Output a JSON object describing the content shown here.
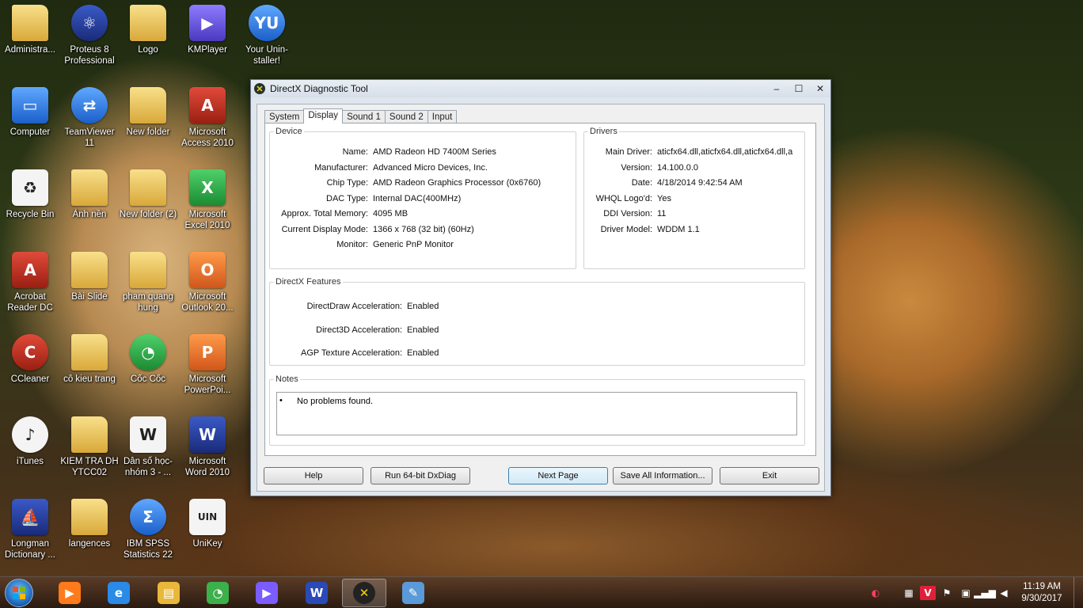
{
  "desktop": {
    "icons": [
      {
        "label": "Administra...",
        "icon": "user-folder-icon"
      },
      {
        "label": "Proteus 8 Professional",
        "icon": "proteus-icon"
      },
      {
        "label": "Logo",
        "icon": "folder-icon"
      },
      {
        "label": "KMPlayer",
        "icon": "kmplayer-icon"
      },
      {
        "label": "Your Unin-staller!",
        "icon": "uninstaller-icon"
      },
      {
        "label": "Computer",
        "icon": "computer-icon"
      },
      {
        "label": "TeamViewer 11",
        "icon": "teamviewer-icon"
      },
      {
        "label": "New folder",
        "icon": "folder-icon"
      },
      {
        "label": "Microsoft Access 2010",
        "icon": "access-icon"
      },
      {
        "label": "Recycle Bin",
        "icon": "recycle-bin-icon"
      },
      {
        "label": "Ảnh nền",
        "icon": "folder-icon"
      },
      {
        "label": "New folder (2)",
        "icon": "folder-icon"
      },
      {
        "label": "Microsoft Excel 2010",
        "icon": "excel-icon"
      },
      {
        "label": "Acrobat Reader DC",
        "icon": "acrobat-icon"
      },
      {
        "label": "Bài Slide",
        "icon": "folder-icon"
      },
      {
        "label": "pham quang hung",
        "icon": "folder-icon"
      },
      {
        "label": "Microsoft Outlook 20...",
        "icon": "outlook-icon"
      },
      {
        "label": "CCleaner",
        "icon": "ccleaner-icon"
      },
      {
        "label": "cô kieu trang",
        "icon": "folder-icon"
      },
      {
        "label": "Cốc Cốc",
        "icon": "coccoc-icon"
      },
      {
        "label": "Microsoft PowerPoi...",
        "icon": "powerpoint-icon"
      },
      {
        "label": "iTunes",
        "icon": "itunes-icon"
      },
      {
        "label": "KIEM TRA DH YTCC02",
        "icon": "folder-icon"
      },
      {
        "label": "Dân số học- nhóm 3 - ...",
        "icon": "word-doc-icon"
      },
      {
        "label": "Microsoft Word 2010",
        "icon": "word-icon"
      },
      {
        "label": "Longman Dictionary ...",
        "icon": "longman-icon"
      },
      {
        "label": "langences",
        "icon": "folder-icon"
      },
      {
        "label": "IBM SPSS Statistics 22",
        "icon": "spss-icon"
      },
      {
        "label": "UniKey",
        "icon": "unikey-icon"
      }
    ]
  },
  "window": {
    "title": "DirectX Diagnostic Tool",
    "controls": {
      "minimize": "‒",
      "maximize": "☐",
      "close": "✕"
    },
    "tabs": [
      "System",
      "Display",
      "Sound 1",
      "Sound 2",
      "Input"
    ],
    "active_tab": "Display",
    "device": {
      "legend": "Device",
      "rows": [
        {
          "k": "Name:",
          "v": "AMD Radeon HD 7400M Series"
        },
        {
          "k": "Manufacturer:",
          "v": "Advanced Micro Devices, Inc."
        },
        {
          "k": "Chip Type:",
          "v": "AMD Radeon Graphics Processor (0x6760)"
        },
        {
          "k": "DAC Type:",
          "v": "Internal DAC(400MHz)"
        },
        {
          "k": "Approx. Total Memory:",
          "v": "4095 MB"
        },
        {
          "k": "Current Display Mode:",
          "v": "1366 x 768 (32 bit) (60Hz)"
        },
        {
          "k": "Monitor:",
          "v": "Generic PnP Monitor"
        }
      ]
    },
    "drivers": {
      "legend": "Drivers",
      "rows": [
        {
          "k": "Main Driver:",
          "v": "aticfx64.dll,aticfx64.dll,aticfx64.dll,a"
        },
        {
          "k": "Version:",
          "v": "14.100.0.0"
        },
        {
          "k": "Date:",
          "v": "4/18/2014 9:42:54 AM"
        },
        {
          "k": "WHQL Logo'd:",
          "v": "Yes"
        },
        {
          "k": "DDI Version:",
          "v": "11"
        },
        {
          "k": "Driver Model:",
          "v": "WDDM 1.1"
        }
      ]
    },
    "features": {
      "legend": "DirectX Features",
      "rows": [
        {
          "k": "DirectDraw Acceleration:",
          "v": "Enabled"
        },
        {
          "k": "Direct3D Acceleration:",
          "v": "Enabled"
        },
        {
          "k": "AGP Texture Acceleration:",
          "v": "Enabled"
        }
      ]
    },
    "notes": {
      "legend": "Notes",
      "bullet": "•",
      "items": [
        "No problems found."
      ]
    },
    "buttons": {
      "help": "Help",
      "run64": "Run 64-bit DxDiag",
      "next": "Next Page",
      "save": "Save All Information...",
      "exit": "Exit"
    }
  },
  "taskbar": {
    "pinned": [
      "kmplayer-icon",
      "internet-explorer-icon",
      "file-explorer-icon",
      "coccoc-icon",
      "kmplayer-icon",
      "word-icon",
      "directx-icon",
      "paint-icon"
    ],
    "clock": {
      "time": "11:19 AM",
      "date": "9/30/2017"
    }
  }
}
